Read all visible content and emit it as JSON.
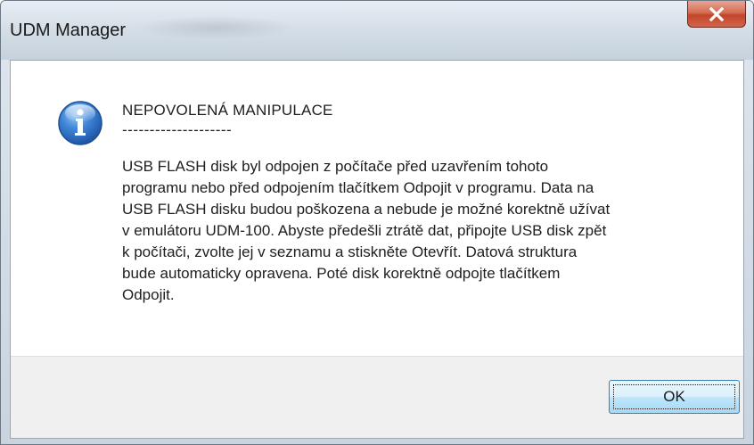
{
  "window": {
    "title": "UDM Manager",
    "close_icon": "close-icon"
  },
  "dialog": {
    "icon": "info-icon",
    "heading": "NEPOVOLENÁ MANIPULACE",
    "separator": "--------------------",
    "message": "USB FLASH disk byl odpojen z počítače před uzavřením tohoto\nprogramu nebo před odpojením tlačítkem Odpojit v programu. Data na\nUSB FLASH disku budou poškozena a nebude je možné korektně užívat\nv emulátoru UDM-100. Abyste předešli ztrátě dat, připojte USB disk zpět\nk počítači, zvolte jej v seznamu a stiskněte Otevřít. Datová struktura\nbude automaticky opravena. Poté disk korektně odpojte tlačítkem\nOdpojit.",
    "ok_label": "OK"
  },
  "colors": {
    "close_button": "#c2452a",
    "info_icon": "#2a6fc9",
    "ok_border": "#3c7fb1"
  }
}
